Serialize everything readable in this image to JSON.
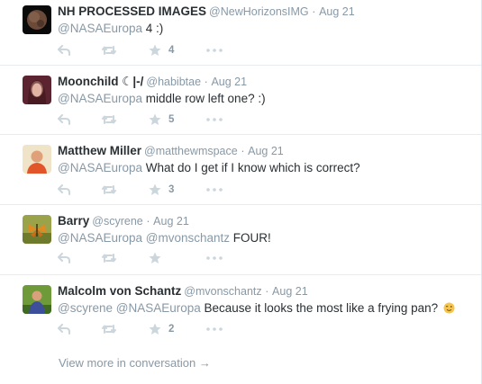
{
  "tweets": [
    {
      "fullname": "NH PROCESSED IMAGES",
      "handle": "@NewHorizonsIMG",
      "sep": "·",
      "time": "Aug 21",
      "mentions": [
        "@NASAEuropa"
      ],
      "text": "4 :)",
      "favorite_count": "4",
      "avatar_icon": "planet-avatar-icon"
    },
    {
      "fullname": "Moonchild ☾|-/",
      "handle": "@habibtae",
      "sep": "·",
      "time": "Aug 21",
      "mentions": [
        "@NASAEuropa"
      ],
      "text": "middle row left one? :)",
      "favorite_count": "5",
      "avatar_icon": "person-avatar-icon"
    },
    {
      "fullname": "Matthew Miller",
      "handle": "@matthewmspace",
      "sep": "·",
      "time": "Aug 21",
      "mentions": [
        "@NASAEuropa"
      ],
      "text": "What do I get if I know which is correct?",
      "favorite_count": "3",
      "avatar_icon": "person-avatar-icon"
    },
    {
      "fullname": "Barry",
      "handle": "@scyrene",
      "sep": "·",
      "time": "Aug 21",
      "mentions": [
        "@NASAEuropa",
        "@mvonschantz"
      ],
      "text": "FOUR!",
      "favorite_count": "",
      "avatar_icon": "butterfly-avatar-icon"
    },
    {
      "fullname": "Malcolm von Schantz",
      "handle": "@mvonschantz",
      "sep": "·",
      "time": "Aug 21",
      "mentions": [
        "@scyrene",
        "@NASAEuropa"
      ],
      "text": "Because it looks the most like a frying pan?",
      "favorite_count": "2",
      "avatar_icon": "person-avatar-icon"
    }
  ],
  "view_more": "View more in conversation →",
  "colors": {
    "text": "#292f33",
    "muted": "#8899a6",
    "icon": "#ccd6dd",
    "border": "#e6ecf0"
  }
}
